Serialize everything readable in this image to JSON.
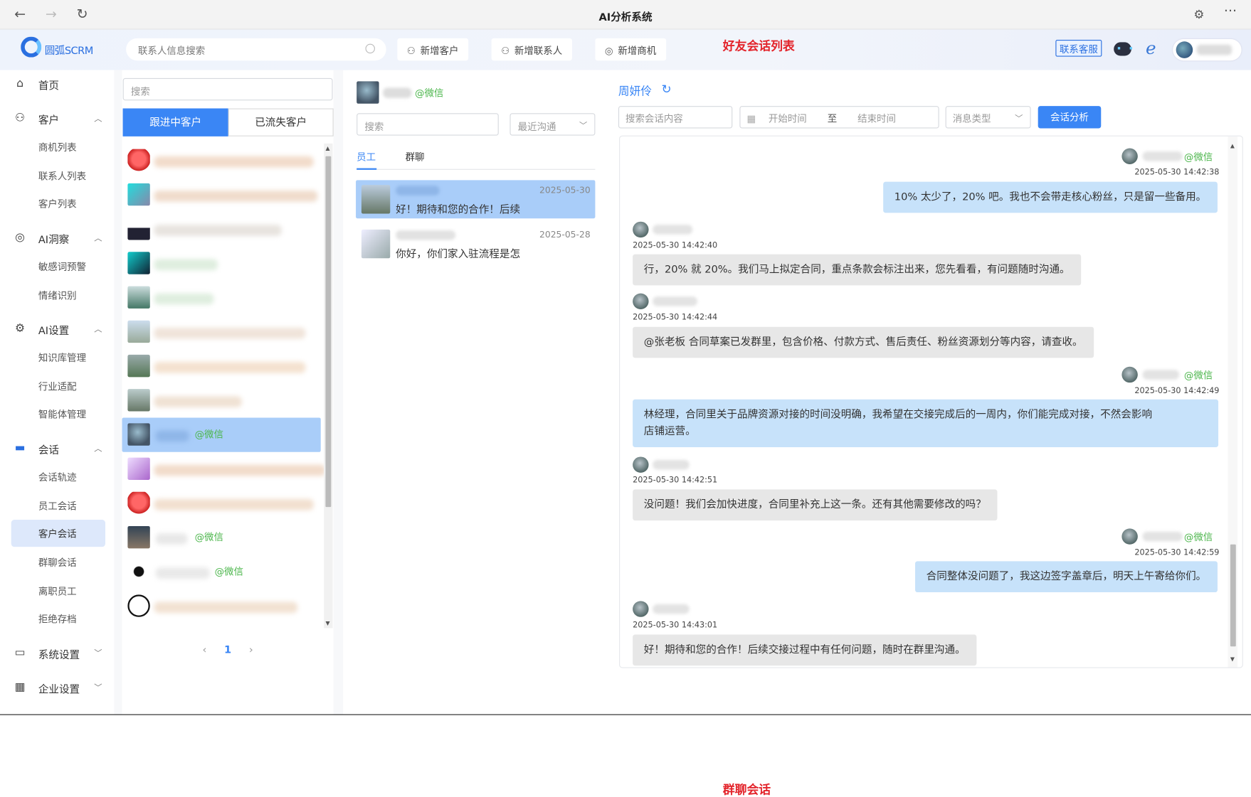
{
  "browser": {
    "title": "AI分析系统",
    "back": "←",
    "forward": "→",
    "reload": "↻",
    "more": "···"
  },
  "header": {
    "logo_text": "圆弧SCRM",
    "search_placeholder": "联系人信息搜索",
    "buttons": [
      {
        "label": "新增客户",
        "icon": "add-user-icon"
      },
      {
        "label": "新增联系人",
        "icon": "contacts-icon"
      },
      {
        "label": "新增商机",
        "icon": "opportunity-icon"
      }
    ],
    "annotation_top": "好友会话列表",
    "support_label": "联系客服"
  },
  "annotation_bottom": "群聊会话",
  "sidebar": {
    "home": "首页",
    "customers": {
      "label": "客户",
      "items": [
        "商机列表",
        "联系人列表",
        "客户列表"
      ]
    },
    "ai_insight": {
      "label": "AI洞察",
      "items": [
        "敏感词预警",
        "情绪识别"
      ]
    },
    "ai_settings": {
      "label": "AI设置",
      "items": [
        "知识库管理",
        "行业适配",
        "智能体管理"
      ]
    },
    "session": {
      "label": "会话",
      "items": [
        "会话轨迹",
        "员工会话",
        "客户会话",
        "群聊会话",
        "离职员工",
        "拒绝存档"
      ]
    },
    "system": "系统设置",
    "enterprise": "企业设置"
  },
  "customer_panel": {
    "search_placeholder": "搜索",
    "tab_active": "跟进中客户",
    "tab_inactive": "已流失客户",
    "wechat_tag": "@微信",
    "page": "1"
  },
  "conv_panel": {
    "wechat_tag": "@微信",
    "search_placeholder": "搜索",
    "sort_select": "最近沟通",
    "tabs": [
      "员工",
      "群聊"
    ],
    "conversations": [
      {
        "date": "2025-05-30",
        "preview": "好！期待和您的合作！后续"
      },
      {
        "date": "2025-05-28",
        "preview": "你好，你们家入驻流程是怎"
      }
    ]
  },
  "chat_panel": {
    "contact_name": "周妍伶",
    "search_placeholder": "搜索会话内容",
    "start_placeholder": "开始时间",
    "range_sep": "至",
    "end_placeholder": "结束时间",
    "msg_type_placeholder": "消息类型",
    "analyze_button": "会话分析",
    "wechat_tag": "@微信",
    "messages": [
      {
        "side": "right",
        "time": "2025-05-30 14:42:38",
        "text": "10% 太少了，20% 吧。我也不会带走核心粉丝，只是留一些备用。"
      },
      {
        "side": "left",
        "time": "2025-05-30 14:42:40",
        "text": "行，20% 就 20%。我们马上拟定合同，重点条款会标注出来，您先看看，有问题随时沟通。"
      },
      {
        "side": "left",
        "time": "2025-05-30 14:42:44",
        "text": "@张老板 合同草案已发群里，包含价格、付款方式、售后责任、粉丝资源划分等内容，请查收。"
      },
      {
        "side": "right",
        "time": "2025-05-30 14:42:49",
        "text1": "林经理，合同里关于品牌资源对接的时间没明确，我希望在交接完成后的一周内，你们能完成对接，不然会影响",
        "text2": "店铺运营。"
      },
      {
        "side": "left",
        "time": "2025-05-30 14:42:51",
        "text": "没问题！我们会加快进度，合同里补充上这一条。还有其他需要修改的吗？"
      },
      {
        "side": "right",
        "time": "2025-05-30 14:42:59",
        "text": "合同整体没问题了，我这边签字盖章后，明天上午寄给你们。"
      },
      {
        "side": "left",
        "time": "2025-05-30 14:43:01",
        "text": "好！期待和您的合作！后续交接过程中有任何问题，随时在群里沟通。"
      }
    ]
  },
  "colors": {
    "accent": "#3a86f5",
    "selected": "#a9cdf9",
    "wechat": "#4cb64c",
    "annotation": "#e3242b"
  }
}
